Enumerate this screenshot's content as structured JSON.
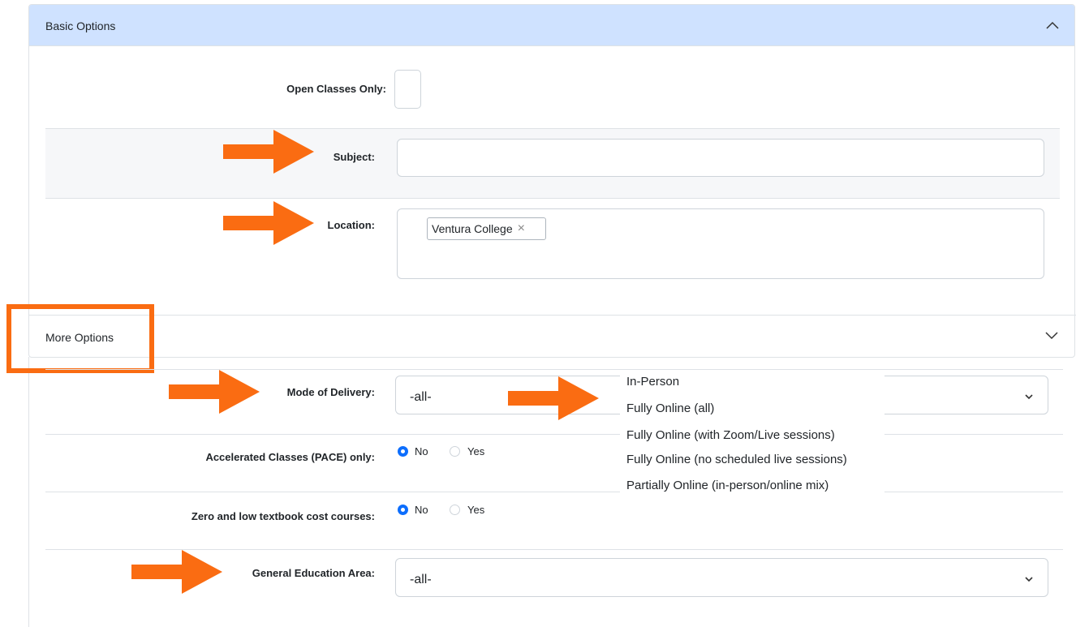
{
  "basic_options": {
    "title": "Basic Options",
    "open_classes_label": "Open Classes Only:",
    "subject_label": "Subject:",
    "subject_value": "",
    "location_label": "Location:",
    "location_tags": [
      "Ventura College"
    ]
  },
  "more_options": {
    "title": "More Options",
    "mode_label": "Mode of Delivery:",
    "mode_value": "-all-",
    "mode_options": [
      "In-Person",
      "Fully Online (all)",
      "Fully Online (with Zoom/Live sessions)",
      "Fully Online (no scheduled live sessions)",
      "Partially Online (in-person/online mix)"
    ],
    "pace_label": "Accelerated Classes (PACE) only:",
    "pace_no": "No",
    "pace_yes": "Yes",
    "pace_selected": "No",
    "ztc_label": "Zero and low textbook cost courses:",
    "ztc_no": "No",
    "ztc_yes": "Yes",
    "ztc_selected": "No",
    "ge_label": "General Education Area:",
    "ge_value": "-all-"
  },
  "colors": {
    "header_bg": "#cfe2ff",
    "radio_selected": "#0d6efd",
    "annotation_arrow": "#fa6c12"
  },
  "icons": [
    "chevron-up-icon",
    "chevron-down-icon",
    "close-icon",
    "annotation-arrow"
  ]
}
